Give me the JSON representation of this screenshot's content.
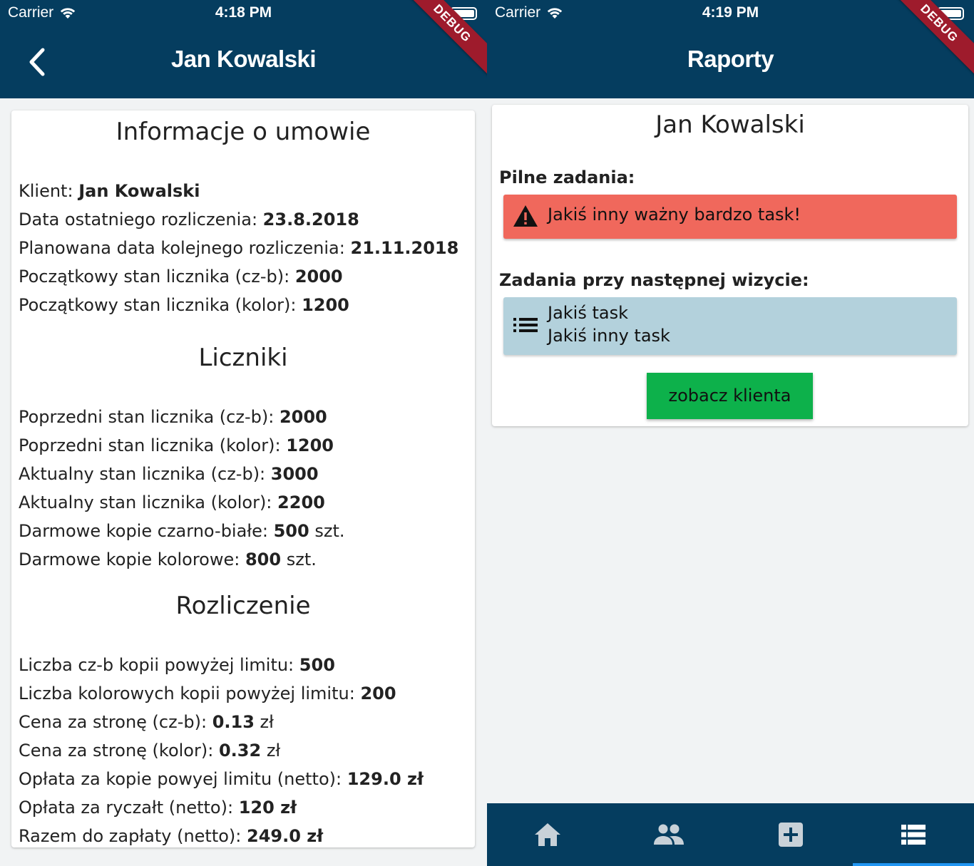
{
  "left_screen": {
    "status": {
      "carrier": "Carrier",
      "time": "4:18 PM"
    },
    "debug_banner": "DEBUG",
    "appbar_title": "Jan Kowalski",
    "sections": [
      {
        "title": "Informacje o umowie",
        "rows": [
          {
            "label": "Klient:",
            "value": "Jan Kowalski",
            "suffix": ""
          },
          {
            "label": "Data ostatniego rozliczenia:",
            "value": "23.8.2018",
            "suffix": ""
          },
          {
            "label": "Planowana data kolejnego rozliczenia:",
            "value": "21.11.2018",
            "suffix": ""
          },
          {
            "label": "Początkowy stan licznika (cz-b):",
            "value": "2000",
            "suffix": ""
          },
          {
            "label": "Początkowy stan licznika (kolor):",
            "value": "1200",
            "suffix": ""
          }
        ]
      },
      {
        "title": "Liczniki",
        "rows": [
          {
            "label": "Poprzedni stan licznika (cz-b):",
            "value": "2000",
            "suffix": ""
          },
          {
            "label": "Poprzedni stan licznika (kolor):",
            "value": "1200",
            "suffix": ""
          },
          {
            "label": "Aktualny stan licznika (cz-b):",
            "value": "3000",
            "suffix": ""
          },
          {
            "label": "Aktualny stan licznika (kolor):",
            "value": "2200",
            "suffix": ""
          },
          {
            "label": "Darmowe kopie czarno-białe:",
            "value": "500",
            "suffix": "szt."
          },
          {
            "label": "Darmowe kopie kolorowe:",
            "value": "800",
            "suffix": "szt."
          }
        ]
      },
      {
        "title": "Rozliczenie",
        "rows": [
          {
            "label": "Liczba cz-b kopii powyżej limitu:",
            "value": "500",
            "suffix": ""
          },
          {
            "label": "Liczba kolorowych kopii powyżej limitu:",
            "value": "200",
            "suffix": ""
          },
          {
            "label": "Cena za stronę (cz-b):",
            "value": "0.13",
            "suffix": "zł"
          },
          {
            "label": "Cena za stronę (kolor):",
            "value": "0.32",
            "suffix": "zł"
          },
          {
            "label": "Opłata za kopie powyej limitu (netto):",
            "value": "129.0 zł",
            "suffix": ""
          },
          {
            "label": "Opłata za ryczałt (netto):",
            "value": "120 zł",
            "suffix": ""
          },
          {
            "label": "Razem do zapłaty (netto):",
            "value": "249.0 zł",
            "suffix": ""
          }
        ]
      }
    ]
  },
  "right_screen": {
    "status": {
      "carrier": "Carrier",
      "time": "4:19 PM"
    },
    "debug_banner": "DEBUG",
    "appbar_title": "Raporty",
    "client_name": "Jan Kowalski",
    "urgent_label": "Pilne zadania:",
    "urgent_task": "Jakiś inny ważny bardzo task!",
    "next_visit_label": "Zadania przy następnej wizycie:",
    "next_visit_tasks": [
      "Jakiś task",
      "Jakiś inny task"
    ],
    "client_button": "zobacz klienta",
    "nav": [
      {
        "icon": "home-icon",
        "active": false
      },
      {
        "icon": "people-icon",
        "active": false
      },
      {
        "icon": "add-box-icon",
        "active": false
      },
      {
        "icon": "list-icon",
        "active": true
      }
    ]
  },
  "colors": {
    "appbar": "#053d5f",
    "urgent": "#f0685c",
    "tasks": "#b3d1dc",
    "button": "#0db14b",
    "active_tab": "#2196f3"
  }
}
